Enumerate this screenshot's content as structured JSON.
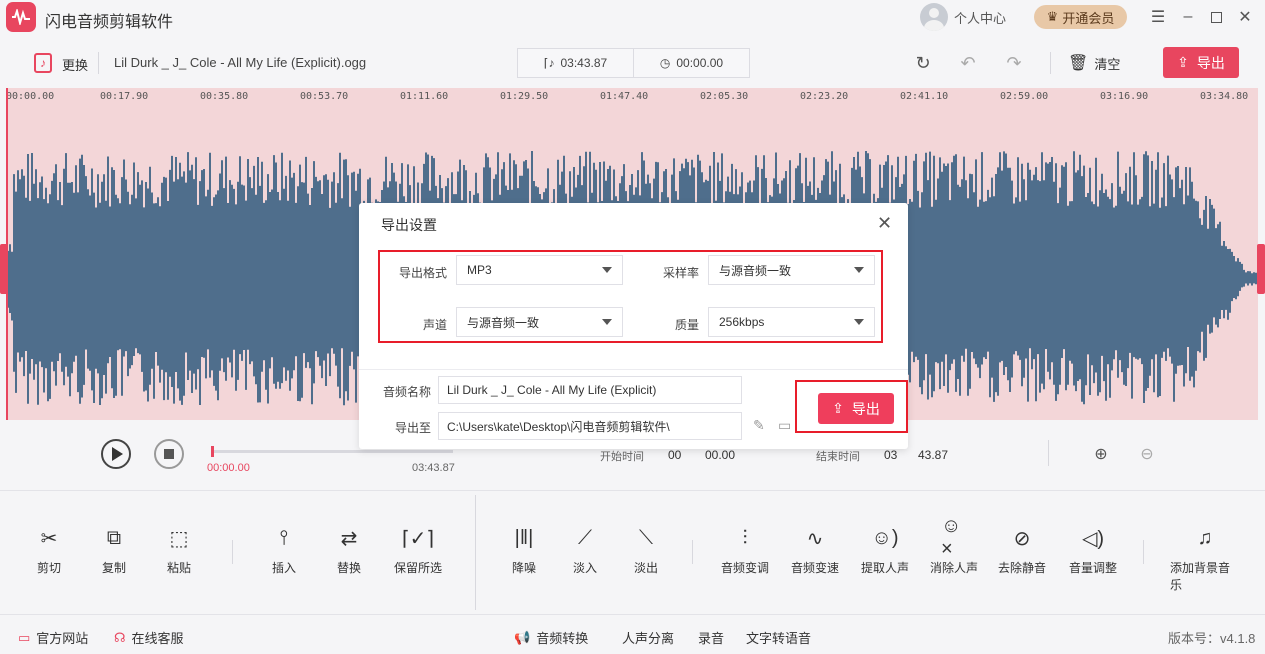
{
  "app": {
    "title": "闪电音频剪辑软件"
  },
  "user": {
    "label": "个人中心",
    "vip_label": "开通会员"
  },
  "toolbar": {
    "replace_label": "更换",
    "filename": "Lil Durk _ J_ Cole - All My Life (Explicit).ogg",
    "duration": "03:43.87",
    "position": "00:00.00",
    "clear_label": "清空",
    "export_label": "导出"
  },
  "ruler": {
    "ticks": [
      "00:00.00",
      "00:17.90",
      "00:35.80",
      "00:53.70",
      "01:11.60",
      "01:29.50",
      "01:47.40",
      "02:05.30",
      "02:23.20",
      "02:41.10",
      "02:59.00",
      "03:16.90",
      "03:34.80"
    ]
  },
  "player": {
    "current": "00:00.00",
    "total": "03:43.87",
    "start_label": "开始时间",
    "start_min": "00",
    "start_sec": "00.00",
    "end_label": "结束时间",
    "end_min": "03",
    "end_sec": "43.87",
    "progress": 0
  },
  "tools": [
    {
      "label": "剪切",
      "icon": "scissors-icon"
    },
    {
      "label": "复制",
      "icon": "copy-icon"
    },
    {
      "label": "粘贴",
      "icon": "paste-icon"
    },
    {
      "label": "插入",
      "icon": "insert-icon"
    },
    {
      "label": "替换",
      "icon": "replace-icon"
    },
    {
      "label": "保留所选",
      "icon": "keep-selection-icon"
    },
    {
      "label": "降噪",
      "icon": "denoise-icon"
    },
    {
      "label": "淡入",
      "icon": "fade-in-icon"
    },
    {
      "label": "淡出",
      "icon": "fade-out-icon"
    },
    {
      "label": "音频变调",
      "icon": "pitch-icon"
    },
    {
      "label": "音频变速",
      "icon": "speed-icon"
    },
    {
      "label": "提取人声",
      "icon": "extract-voice-icon"
    },
    {
      "label": "消除人声",
      "icon": "remove-voice-icon"
    },
    {
      "label": "去除静音",
      "icon": "remove-silence-icon"
    },
    {
      "label": "音量调整",
      "icon": "volume-icon"
    },
    {
      "label": "添加背景音乐",
      "icon": "bg-music-icon"
    }
  ],
  "footer": {
    "website": "官方网站",
    "support": "在线客服",
    "convert": "音频转换",
    "separate": "人声分离",
    "record": "录音",
    "tts": "文字转语音",
    "version": "版本号：v4.1.8"
  },
  "dialog": {
    "title": "导出设置",
    "format_label": "导出格式",
    "format_value": "MP3",
    "samplerate_label": "采样率",
    "samplerate_value": "与源音频一致",
    "channel_label": "声道",
    "channel_value": "与源音频一致",
    "quality_label": "质量",
    "quality_value": "256kbps",
    "name_label": "音频名称",
    "name_value": "Lil Durk _ J_ Cole - All My Life (Explicit)",
    "path_label": "导出至",
    "path_value": "C:\\Users\\kate\\Desktop\\闪电音频剪辑软件\\",
    "export_label": "导出"
  },
  "colors": {
    "accent": "#e8465f",
    "wave": "#4f6e8c",
    "wave_bg": "#f3d6d8",
    "highlight": "#e81d2a"
  }
}
